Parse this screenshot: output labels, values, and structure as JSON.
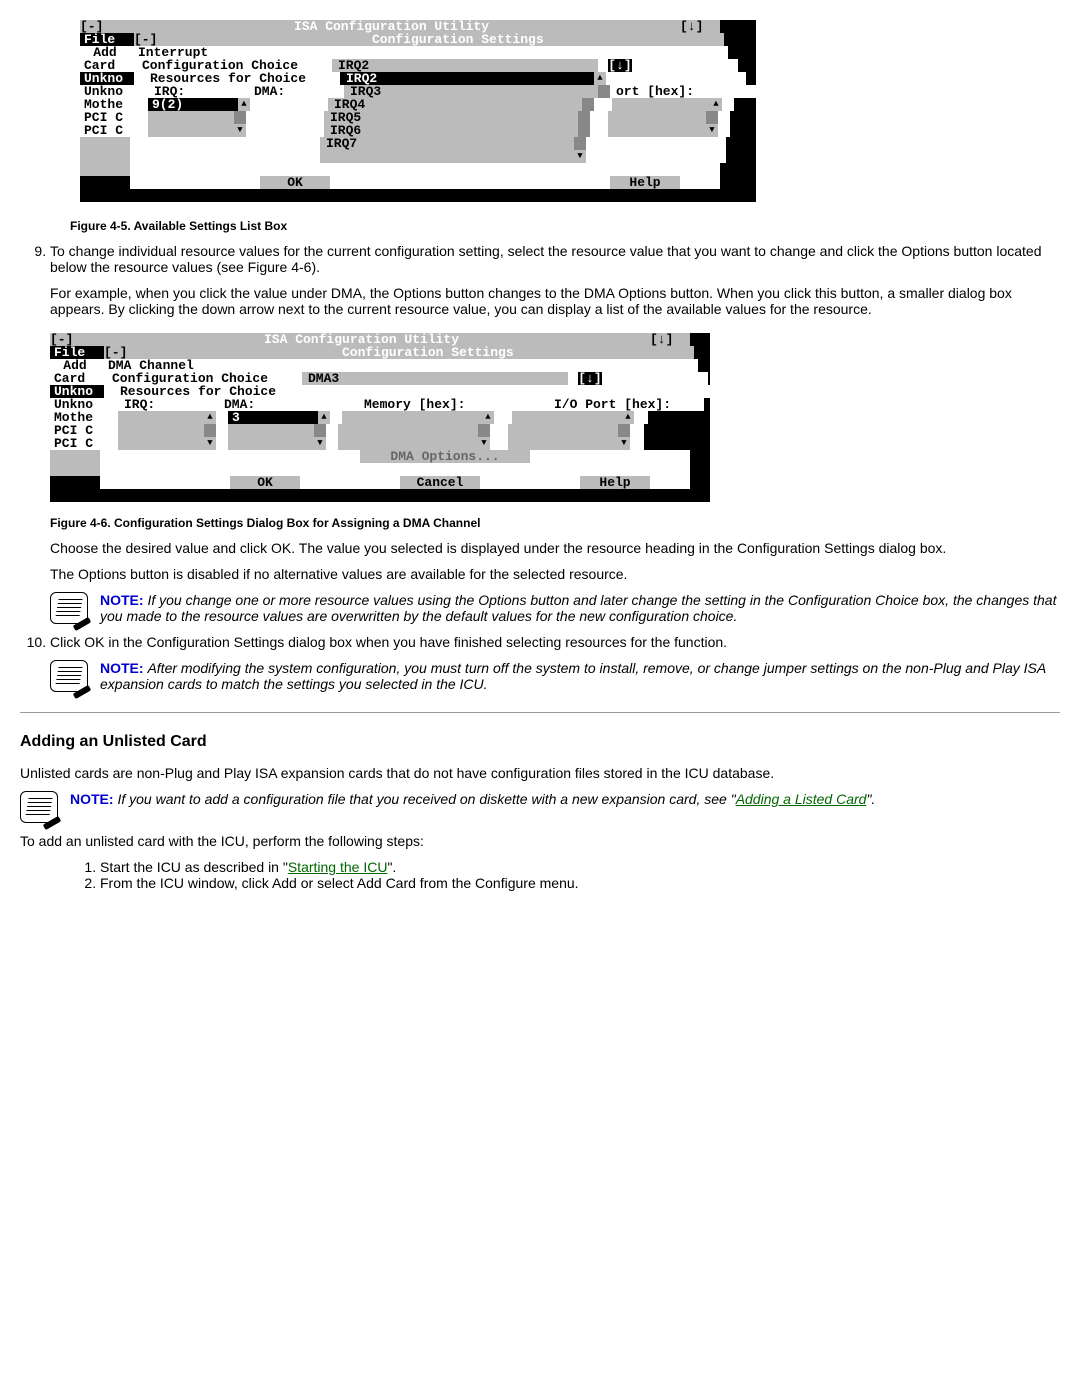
{
  "fig1": {
    "title_app": "ISA Configuration Utility",
    "title_dlg": "Configuration Settings",
    "menu_file": "File",
    "sidebar": [
      "Add",
      "Card",
      "Unkno",
      "Unkno",
      "Mothe",
      "PCI C",
      "PCI C"
    ],
    "lbl_interrupt": "Interrupt",
    "lbl_conf_choice": "Configuration Choice",
    "lbl_resources": "Resources for Choice",
    "lbl_irq": "IRQ:",
    "lbl_dma": "DMA:",
    "choice_value": "IRQ2",
    "list_items": [
      "IRQ2",
      "IRQ3",
      "IRQ4",
      "IRQ5",
      "IRQ6",
      "IRQ7"
    ],
    "irq_selected": "9(2)",
    "col_port": "ort [hex]:",
    "btn_ok": "OK",
    "btn_help": "Help",
    "caption": "Figure 4-5. Available Settings List Box"
  },
  "step9": {
    "text": "To change individual resource values for the current configuration setting, select the resource value that you want to change and click the Options button located below the resource values (see Figure 4-6).",
    "para": "For example, when you click the value under DMA, the Options button changes to the DMA Options button. When you click this button, a smaller dialog box appears. By clicking the down arrow next to the current resource value, you can display a list of the available values for the resource."
  },
  "fig2": {
    "title_app": "ISA Configuration Utility",
    "title_dlg": "Configuration Settings",
    "menu_file": "File",
    "sidebar": [
      "Add",
      "Card",
      "Unkno",
      "Unkno",
      "Mothe",
      "PCI C",
      "PCI C"
    ],
    "lbl_dma_channel": "DMA Channel",
    "lbl_conf_choice": "Configuration Choice",
    "lbl_resources": "Resources for Choice",
    "lbl_irq": "IRQ:",
    "lbl_dma": "DMA:",
    "lbl_memory": "Memory [hex]:",
    "lbl_io_port": "I/O Port [hex]:",
    "choice_value": "DMA3",
    "dma_selected": "3",
    "btn_dma_options": "DMA Options...",
    "btn_ok": "OK",
    "btn_cancel": "Cancel",
    "btn_help": "Help",
    "caption": "Figure 4-6. Configuration Settings Dialog Box for Assigning a DMA Channel"
  },
  "after9": {
    "para1": "Choose the desired value and click OK. The value you selected is displayed under the resource heading in the Configuration Settings dialog box.",
    "para2": "The Options button is disabled if no alternative values are available for the selected resource.",
    "note1_label": "NOTE:",
    "note1_text": " If you change one or more resource values using the Options button and later change the setting in the Configuration Choice box, the changes that you made to the resource values are overwritten by the default values for the new configuration choice."
  },
  "step10": {
    "text": "Click OK in the Configuration Settings dialog box when you have finished selecting resources for the function.",
    "note_label": "NOTE:",
    "note_text": " After modifying the system configuration, you must turn off the system to install, remove, or change jumper settings on the non-Plug and Play ISA expansion cards to match the settings you selected in the ICU."
  },
  "section2": {
    "heading": "Adding an Unlisted Card",
    "intro": "Unlisted cards are non-Plug and Play ISA expansion cards that do not have configuration files stored in the ICU database.",
    "note_label": "NOTE:",
    "note_text_before": " If you want to add a configuration file that you received on diskette with a new expansion card, see \"",
    "note_link": "Adding a Listed Card",
    "note_text_after": "\".",
    "lead": "To add an unlisted card with the ICU, perform the following steps:",
    "li1_before": "Start the ICU as described in \"",
    "li1_link": "Starting the ICU",
    "li1_after": "\".",
    "li2": "From the ICU window, click Add or select Add Card from the Configure menu."
  }
}
